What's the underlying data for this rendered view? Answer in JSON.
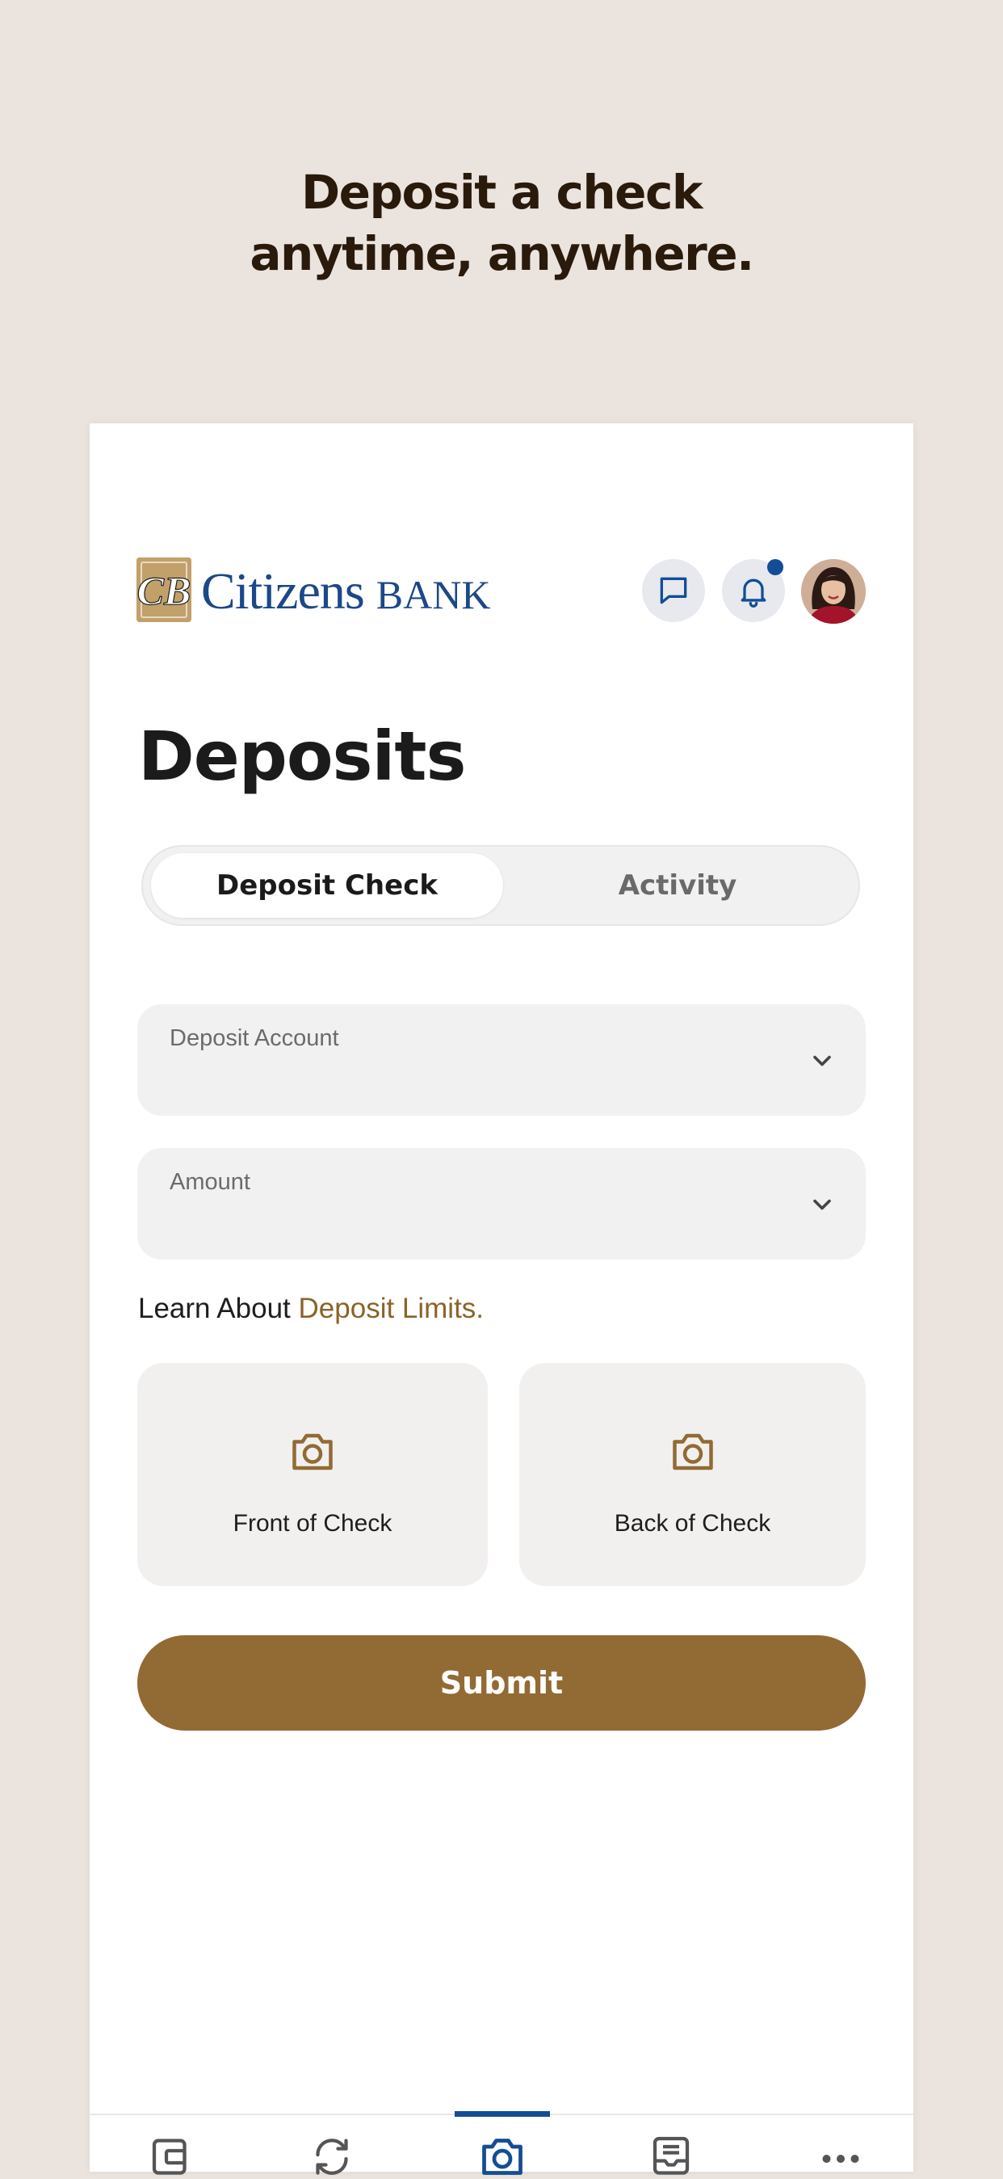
{
  "promo": {
    "headline_line1": "Deposit a check",
    "headline_line2": "anytime, anywhere."
  },
  "header": {
    "logo_text": "Citizens",
    "logo_text_bank": "BANK",
    "logo_mark": "CB",
    "icons": [
      "chat-icon",
      "bell-icon",
      "avatar"
    ],
    "has_notification": true
  },
  "page": {
    "title": "Deposits"
  },
  "tabs": [
    {
      "label": "Deposit Check",
      "active": true
    },
    {
      "label": "Activity",
      "active": false
    }
  ],
  "form": {
    "deposit_account_label": "Deposit Account",
    "amount_label": "Amount",
    "learn_prefix": "Learn About",
    "learn_link": "Deposit Limits.",
    "front_label": "Front of Check",
    "back_label": "Back of Check",
    "submit_label": "Submit"
  },
  "tabbar": {
    "items": [
      "wallet-icon",
      "transfer-icon",
      "camera-icon",
      "inbox-icon",
      "more-icon"
    ],
    "active_index": 2
  },
  "colors": {
    "background": "#ebe4de",
    "accent_brown": "#926a34",
    "brand_blue": "#1c4888",
    "active_blue": "#134d96"
  }
}
